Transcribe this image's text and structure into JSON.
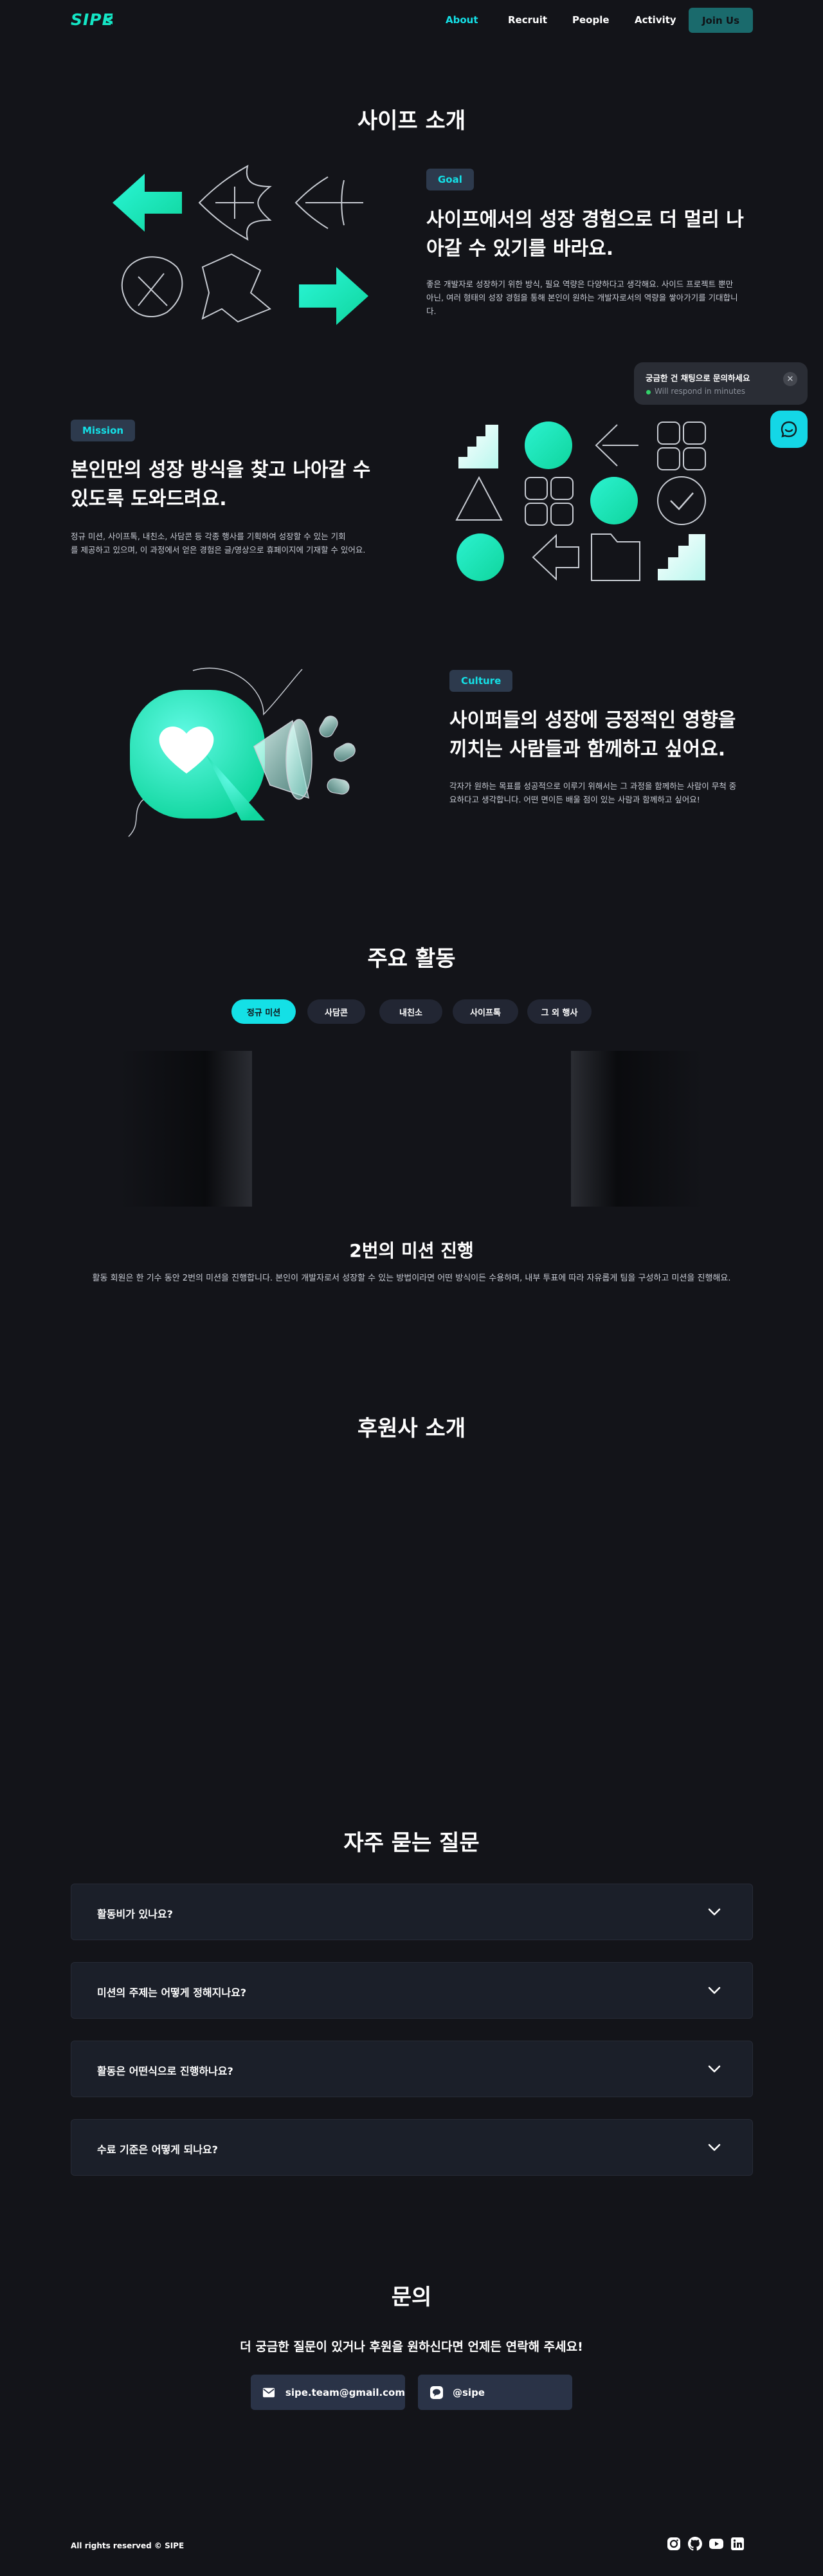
{
  "header": {
    "logo": "SIPE",
    "nav": [
      {
        "label": "About",
        "active": true
      },
      {
        "label": "Recruit",
        "active": false
      },
      {
        "label": "People",
        "active": false
      },
      {
        "label": "Activity",
        "active": false
      }
    ],
    "join_label": "Join Us"
  },
  "about": {
    "title": "사이프 소개",
    "goal": {
      "tag": "Goal",
      "heading_1": "사이프에서의 성장 경험으로 더 멀리 나",
      "heading_2": "아갈 수 있기를 바라요.",
      "desc_1": "좋은 개발자로 성장하기 위한 방식, 필요 역량은 다양하다고 생각해요. 사이드 프로젝트 뿐만",
      "desc_2": "아닌, 여러 형태의 성장 경험을 통해 본인이 원하는 개발자로서의 역량을 쌓아가기를 기대합니",
      "desc_3": "다."
    },
    "mission": {
      "tag": "Mission",
      "heading_1": "본인만의 성장 방식을 찾고 나아갈 수",
      "heading_2": "있도록 도와드려요.",
      "desc_1": "정규 미션, 사이프톡, 내친소, 사담콘 등 각종 행사를 기획하여 성장할 수 있는 기회",
      "desc_2": "를 제공하고 있으며, 이 과정에서 얻은 경험은 글/영상으로 휴페이지에 기재할 수 있어요."
    },
    "culture": {
      "tag": "Culture",
      "heading_1": "사이퍼들의 성장에 긍정적인 영향을",
      "heading_2": "끼치는 사람들과 함께하고 싶어요.",
      "desc_1": "각자가 원하는 목표를 성공적으로 이루기 위해서는 그 과정을 함께하는 사람이 무척 중",
      "desc_2": "요하다고 생각합니다. 어떤 면이든 배울 점이 있는 사람과 함께하고 싶어요!"
    }
  },
  "chat": {
    "title": "궁금한 건 채팅으로 문의하세요",
    "status": "Will respond in minutes",
    "close": "✕"
  },
  "activity": {
    "title": "주요 활동",
    "tabs": [
      {
        "label": "정규 미션",
        "active": true
      },
      {
        "label": "사담콘",
        "active": false
      },
      {
        "label": "내친소",
        "active": false
      },
      {
        "label": "사이프톡",
        "active": false
      },
      {
        "label": "그 외 행사",
        "active": false
      }
    ],
    "mission_title": "2번의 미션 진행",
    "mission_desc": "활동 회원은 한 기수 동안 2번의 미션을 진행합니다. 본인이 개발자로서 성장할 수 있는 방법이라면 어떤 방식이든 수용하며, 내부 투표에 따라 자유롭게 팀을 구성하고 미션을 진행해요."
  },
  "sponsors": {
    "title": "후원사 소개"
  },
  "faq": {
    "title": "자주 묻는 질문",
    "items": [
      {
        "question": "활동비가 있나요?"
      },
      {
        "question": "미션의 주제는 어떻게 정해지나요?"
      },
      {
        "question": "활동은 어떤식으로 진행하나요?"
      },
      {
        "question": "수료 기준은 어떻게 되나요?"
      }
    ]
  },
  "contact": {
    "title": "문의",
    "subtitle": "더 궁금한 질문이 있거나 후원을 원하신다면 언제든 연락해 주세요!",
    "email": "sipe.team@gmail.com",
    "kakao": "@sipe"
  },
  "footer": {
    "copyright": "All rights reserved © SIPE",
    "socials": [
      "instagram-icon",
      "github-icon",
      "youtube-icon",
      "linkedin-icon"
    ]
  },
  "colors": {
    "background": "#131419",
    "accent": "#14e0e6",
    "tag_bg": "#2d3a4d",
    "card_bg": "#1b1f29"
  }
}
